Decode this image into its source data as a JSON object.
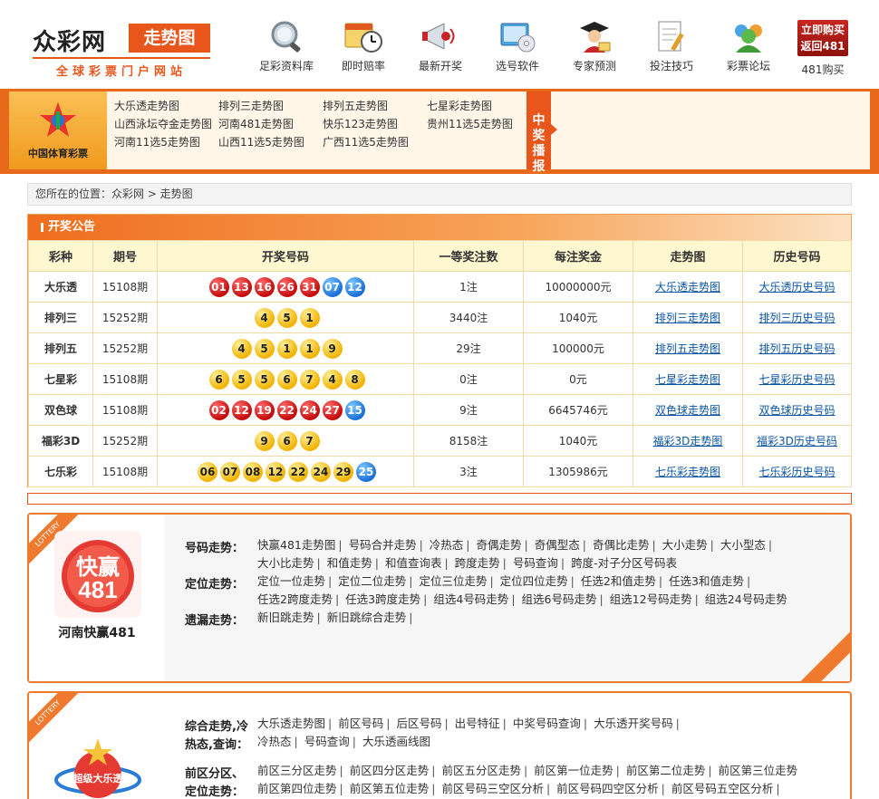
{
  "header": {
    "logo_name": "众彩网",
    "logo_badge": "走势图",
    "logo_tagline": "全球彩票门户网站",
    "nav": [
      {
        "label": "足彩资料库",
        "icon": "magnifier-icon"
      },
      {
        "label": "即时赔率",
        "icon": "calendar-clock-icon"
      },
      {
        "label": "最新开奖",
        "icon": "megaphone-icon"
      },
      {
        "label": "选号软件",
        "icon": "cd-software-icon"
      },
      {
        "label": "专家预测",
        "icon": "graduate-expert-icon"
      },
      {
        "label": "投注技巧",
        "icon": "notepad-pencil-icon"
      },
      {
        "label": "彩票论坛",
        "icon": "users-forum-icon"
      }
    ],
    "buy_badge_line1": "立即购买",
    "buy_badge_line2": "返回481",
    "buy_label": "481购买"
  },
  "band": {
    "sport_logo_text": "中国体育彩票",
    "links": [
      "大乐透走势图",
      "排列三走势图",
      "排列五走势图",
      "七星彩走势图",
      "山西泳坛夺金走势图",
      "河南481走势图",
      "快乐123走势图",
      "贵州11选5走势图",
      "河南11选5走势图",
      "山西11选5走势图",
      "广西11选5走势图"
    ],
    "zjbb": "中奖播报"
  },
  "breadcrumb": "您所在的位置：众彩网 > 走势图",
  "draws": {
    "title": "开奖公告",
    "headers": [
      "彩种",
      "期号",
      "开奖号码",
      "一等奖注数",
      "每注奖金",
      "走势图",
      "历史号码"
    ],
    "rows": [
      {
        "name": "大乐透",
        "issue": "15108期",
        "balls": [
          [
            "01",
            "red"
          ],
          [
            "13",
            "red"
          ],
          [
            "16",
            "red"
          ],
          [
            "26",
            "red"
          ],
          [
            "31",
            "red"
          ],
          [
            "07",
            "blue"
          ],
          [
            "12",
            "blue"
          ]
        ],
        "winners": "1注",
        "prize": "10000000元",
        "trend": "大乐透走势图",
        "history": "大乐透历史号码"
      },
      {
        "name": "排列三",
        "issue": "15252期",
        "balls": [
          [
            "4",
            "yellow"
          ],
          [
            "5",
            "yellow"
          ],
          [
            "1",
            "yellow"
          ]
        ],
        "winners": "3440注",
        "prize": "1040元",
        "trend": "排列三走势图",
        "history": "排列三历史号码"
      },
      {
        "name": "排列五",
        "issue": "15252期",
        "balls": [
          [
            "4",
            "yellow"
          ],
          [
            "5",
            "yellow"
          ],
          [
            "1",
            "yellow"
          ],
          [
            "1",
            "yellow"
          ],
          [
            "9",
            "yellow"
          ]
        ],
        "winners": "29注",
        "prize": "100000元",
        "trend": "排列五走势图",
        "history": "排列五历史号码"
      },
      {
        "name": "七星彩",
        "issue": "15108期",
        "balls": [
          [
            "6",
            "yellow"
          ],
          [
            "5",
            "yellow"
          ],
          [
            "5",
            "yellow"
          ],
          [
            "6",
            "yellow"
          ],
          [
            "7",
            "yellow"
          ],
          [
            "4",
            "yellow"
          ],
          [
            "8",
            "yellow"
          ]
        ],
        "winners": "0注",
        "prize": "0元",
        "trend": "七星彩走势图",
        "history": "七星彩历史号码"
      },
      {
        "name": "双色球",
        "issue": "15108期",
        "balls": [
          [
            "02",
            "red"
          ],
          [
            "12",
            "red"
          ],
          [
            "19",
            "red"
          ],
          [
            "22",
            "red"
          ],
          [
            "24",
            "red"
          ],
          [
            "27",
            "red"
          ],
          [
            "15",
            "blue"
          ]
        ],
        "winners": "9注",
        "prize": "6645746元",
        "trend": "双色球走势图",
        "history": "双色球历史号码"
      },
      {
        "name": "福彩3D",
        "issue": "15252期",
        "balls": [
          [
            "9",
            "yellow"
          ],
          [
            "6",
            "yellow"
          ],
          [
            "7",
            "yellow"
          ]
        ],
        "winners": "8158注",
        "prize": "1040元",
        "trend": "福彩3D走势图",
        "history": "福彩3D历史号码"
      },
      {
        "name": "七乐彩",
        "issue": "15108期",
        "balls": [
          [
            "06",
            "yellow"
          ],
          [
            "07",
            "yellow"
          ],
          [
            "08",
            "yellow"
          ],
          [
            "12",
            "yellow"
          ],
          [
            "22",
            "yellow"
          ],
          [
            "24",
            "yellow"
          ],
          [
            "29",
            "yellow"
          ],
          [
            "25",
            "blue"
          ]
        ],
        "winners": "3注",
        "prize": "1305986元",
        "trend": "七乐彩走势图",
        "history": "七乐彩历史号码"
      }
    ]
  },
  "kuaiying": {
    "ribbon": "LOTTERY",
    "logo_text_top": "快赢",
    "logo_text_num": "481",
    "name": "河南快赢481",
    "label_haoma": "号码走势：",
    "haoma_links": [
      "快赢481走势图",
      "号码合并走势",
      "冷热态",
      "奇偶走势",
      "奇偶型态",
      "奇偶比走势",
      "大小走势",
      "大小型态",
      "大小比走势",
      "和值走势",
      "和值查询表",
      "跨度走势",
      "号码查询",
      "跨度-对子分区号码表"
    ],
    "label_dingwei": "定位走势：",
    "dingwei_links": [
      "定位一位走势",
      "定位二位走势",
      "定位三位走势",
      "定位四位走势",
      "任选2和值走势",
      "任选3和值走势",
      "任选2跨度走势",
      "任选3跨度走势",
      "组选4号码走势",
      "组选6号码走势",
      "组选12号码走势",
      "组选24号码走势"
    ],
    "label_yilou": "遗漏走势：",
    "yilou_links": [
      "新旧跳走势",
      "新旧跳综合走势"
    ]
  },
  "daletou": {
    "ribbon": "LOTTERY",
    "logo_text": "超级大乐透",
    "label_zonghe": "综合走势,冷",
    "label_redian": "热态,查询：",
    "zonghe_links": [
      "大乐透走势图",
      "前区号码",
      "后区号码",
      "出号特征",
      "中奖号码查询",
      "大乐透开奖号码"
    ],
    "redian_links": [
      "冷热态",
      "号码查询",
      "大乐透画线图"
    ],
    "label_qianqu": "前区分区、",
    "label_dingwei": "定位走势：",
    "qianqu_links": [
      "前区三分区走势",
      "前区四分区走势",
      "前区五分区走势",
      "前区第一位走势",
      "前区第二位走势",
      "前区第三位走势"
    ],
    "dingwei_links": [
      "前区第四位走势",
      "前区第五位走势",
      "前区号码三空区分析",
      "前区号码四空区分析",
      "前区号码五空区分析"
    ]
  }
}
